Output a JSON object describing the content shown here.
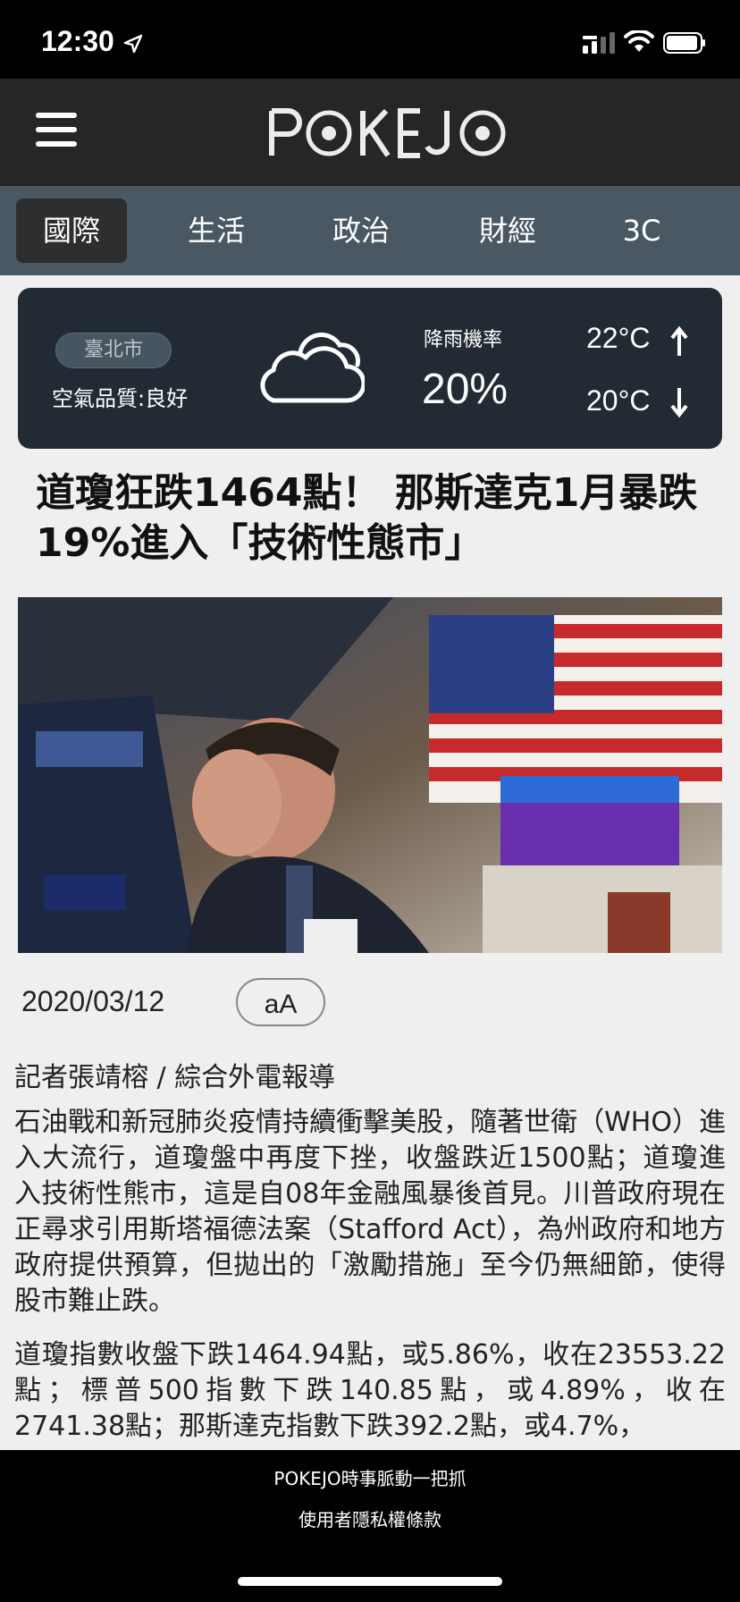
{
  "status_bar": {
    "time": "12:30",
    "icons": [
      "location-arrow-icon",
      "signal-icon",
      "wifi-icon",
      "battery-icon"
    ]
  },
  "header": {
    "logo_text": "POKEJO",
    "menu_icon": "hamburger-icon"
  },
  "tabs": [
    {
      "label": "國際",
      "active": true
    },
    {
      "label": "生活",
      "active": false
    },
    {
      "label": "政治",
      "active": false
    },
    {
      "label": "財經",
      "active": false
    },
    {
      "label": "3C",
      "active": false
    }
  ],
  "weather": {
    "city": "臺北市",
    "air_quality": "空氣品質:良好",
    "condition_icon": "cloud-icon",
    "rain_label": "降雨機率",
    "rain_value": "20%",
    "high": "22°C",
    "low": "20°C"
  },
  "article": {
    "title": "道瓊狂跌1464點！ 那斯達克1月暴跌19%進入「技術性態市」",
    "date": "2020/03/12",
    "font_button": "aA",
    "byline": "記者張靖榕 / 綜合外電報導",
    "paragraphs": [
      "石油戰和新冠肺炎疫情持續衝擊美股，隨著世衛（WHO）進入大流行，道瓊盤中再度下挫，收盤跌近1500點；道瓊進入技術性熊市，這是自08年金融風暴後首見。川普政府現在正尋求引用斯塔福德法案（Stafford Act），為州政府和地方政府提供預算，但拋出的「激勵措施」至今仍無細節，使得股市難止跌。",
      "道瓊指數收盤下跌1464.94點，或5.86%，收在23553.22點；標普500指數下跌140.85點，或4.89%，收在2741.38點；那斯達克指數下跌392.2點，或4.7%，"
    ]
  },
  "footer": {
    "tagline": "POKEJO時事脈動一把抓",
    "privacy": "使用者隱私權條款"
  },
  "colors": {
    "header_bg": "#262626",
    "tabs_bg": "#4a5863",
    "weather_bg": "#222b33",
    "page_bg": "#efefef"
  }
}
